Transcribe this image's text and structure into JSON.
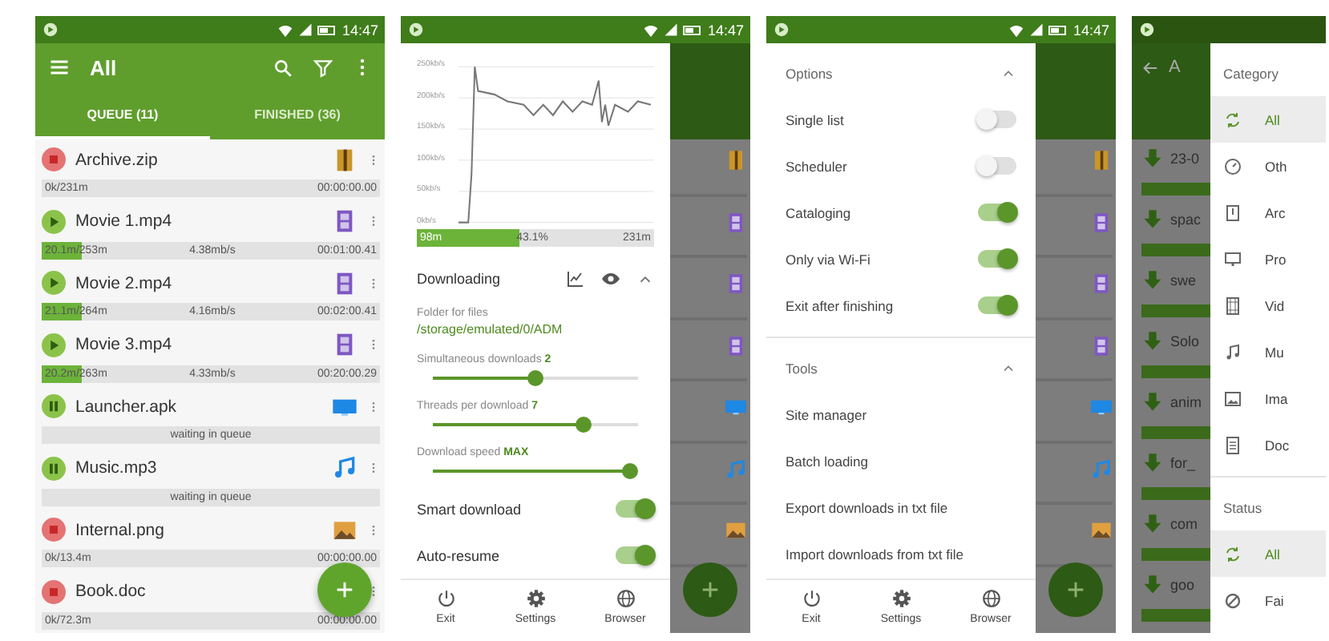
{
  "screens": [
    {
      "kind": "queue",
      "status_bar": {
        "time": "14:47"
      },
      "toolbar": {
        "title": "All"
      },
      "tabs": [
        {
          "label": "QUEUE (11)",
          "selected": true
        },
        {
          "label": "FINISHED (36)",
          "selected": false
        }
      ],
      "downloads": [
        {
          "name": "Archive.zip",
          "kind": "archive",
          "stopped": true,
          "paused": false,
          "progress": "0k/231m",
          "time": "00:00:00.00"
        },
        {
          "name": "Movie 1.mp4",
          "kind": "video",
          "stopped": false,
          "paused": false,
          "level": 0.12,
          "progress": "20.1m/253m",
          "speed": "4.38mb/s",
          "time": "00:01:00.41"
        },
        {
          "name": "Movie 2.mp4",
          "kind": "video",
          "stopped": false,
          "paused": false,
          "level": 0.12,
          "progress": "21.1m/264m",
          "speed": "4.16mb/s",
          "time": "00:02:00.41"
        },
        {
          "name": "Movie 3.mp4",
          "kind": "video",
          "stopped": false,
          "paused": false,
          "level": 0.12,
          "progress": "20.2m/263m",
          "speed": "4.33mb/s",
          "time": "00:20:00.29"
        },
        {
          "name": "Launcher.apk",
          "kind": "app",
          "stopped": false,
          "paused": true,
          "note": "waiting in queue"
        },
        {
          "name": "Music.mp3",
          "kind": "music",
          "stopped": false,
          "paused": true,
          "note": "waiting in queue"
        },
        {
          "name": "Internal.png",
          "kind": "image",
          "stopped": true,
          "paused": false,
          "progress": "0k/13.4m",
          "time": "00:00:00.00"
        },
        {
          "name": "Book.doc",
          "stopped": true,
          "paused": false,
          "progress": "0k/72.3m",
          "time": "00:00:00.00"
        }
      ]
    },
    {
      "kind": "settings",
      "status_bar": {
        "time": "14:47"
      },
      "graph": {
        "labels": [
          "250kb/s",
          "200kb/s",
          "150kb/s",
          "100kb/s",
          "50kb/s",
          "0kb/s"
        ]
      },
      "progress": {
        "level": 0.431,
        "done": "98m",
        "percent": "43.1%",
        "total": "231m"
      },
      "section": {
        "title": "Downloading",
        "expanded": true
      },
      "folder": {
        "label": "Folder for files",
        "path": "/storage/emulated/0/ADM"
      },
      "sliders": [
        {
          "label": "Simultaneous downloads **2**",
          "level": 0.5
        },
        {
          "label": "Threads per download **7**",
          "level": 0.75
        },
        {
          "label": "Download speed **MAX**",
          "level": 1
        }
      ],
      "switches": [
        {
          "label": "Smart download",
          "on": true
        },
        {
          "label": "Auto-resume",
          "on": true
        }
      ],
      "bottom_bar": [
        {
          "kind": "exit",
          "label": "Exit"
        },
        {
          "kind": "settings",
          "label": "Settings"
        },
        {
          "kind": "browser",
          "label": "Browser"
        }
      ],
      "background": [
        {
          "kind": "archive"
        },
        {
          "kind": "video"
        },
        {
          "kind": "video"
        },
        {
          "kind": "video"
        },
        {
          "kind": "app"
        },
        {
          "kind": "music"
        },
        {
          "kind": "image"
        }
      ]
    },
    {
      "kind": "options",
      "status_bar": {
        "time": "14:47"
      },
      "sections": [
        {
          "title": "Options",
          "expanded": true,
          "items": [
            {
              "kind": "switch",
              "label": "Single list",
              "on": false
            },
            {
              "kind": "switch",
              "label": "Scheduler",
              "on": false
            },
            {
              "kind": "switch",
              "label": "Cataloging",
              "on": true
            },
            {
              "kind": "switch",
              "label": "Only via Wi-Fi",
              "on": true
            },
            {
              "kind": "switch",
              "label": "Exit after finishing",
              "on": true
            }
          ]
        },
        {
          "title": "Tools",
          "expanded": true,
          "items": [
            {
              "kind": "action",
              "label": "Site manager"
            },
            {
              "kind": "action",
              "label": "Batch loading"
            },
            {
              "kind": "action",
              "label": "Export downloads in txt file"
            },
            {
              "kind": "action",
              "label": "Import downloads from txt file"
            }
          ]
        }
      ],
      "bottom_bar": [
        {
          "kind": "exit",
          "label": "Exit"
        },
        {
          "kind": "settings",
          "label": "Settings"
        },
        {
          "kind": "browser",
          "label": "Browser"
        }
      ],
      "background": [
        {
          "kind": "archive"
        },
        {
          "kind": "video"
        },
        {
          "kind": "video"
        },
        {
          "kind": "video"
        },
        {
          "kind": "app"
        },
        {
          "kind": "music"
        },
        {
          "kind": "image"
        }
      ]
    },
    {
      "kind": "categories",
      "main": {
        "title": "A",
        "rows": [
          {
            "name": "23-0"
          },
          {
            "name": "spac"
          },
          {
            "name": "swe"
          },
          {
            "name": "Solo"
          },
          {
            "name": "anim"
          },
          {
            "name": "for_"
          },
          {
            "name": "com"
          },
          {
            "name": "goo"
          }
        ]
      },
      "sections": [
        {
          "title": "Category",
          "items": [
            {
              "kind": "all",
              "label": "All",
              "selected": true
            },
            {
              "kind": "other",
              "label": "Oth",
              "selected": false
            },
            {
              "kind": "archive",
              "label": "Arc",
              "selected": false
            },
            {
              "kind": "app",
              "label": "Pro",
              "selected": false
            },
            {
              "kind": "video",
              "label": "Vid",
              "selected": false
            },
            {
              "kind": "music",
              "label": "Mu",
              "selected": false
            },
            {
              "kind": "image",
              "label": "Ima",
              "selected": false
            },
            {
              "kind": "document",
              "label": "Doc",
              "selected": false
            }
          ]
        },
        {
          "title": "Status",
          "items": [
            {
              "kind": "all",
              "label": "All",
              "selected": true
            },
            {
              "kind": "failed",
              "label": "Fai",
              "selected": false
            }
          ]
        }
      ]
    }
  ]
}
